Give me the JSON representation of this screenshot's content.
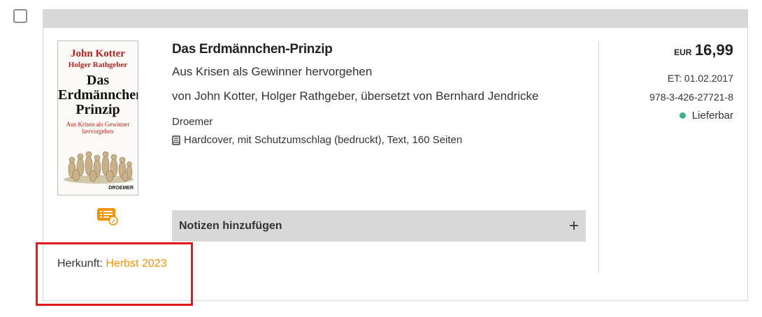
{
  "book": {
    "title": "Das Erdmännchen-Prinzip",
    "subtitle": "Aus Krisen als Gewinner hervorgehen",
    "authors": "von John Kotter, Holger Rathgeber, übersetzt von Bernhard Jendricke",
    "publisher": "Droemer",
    "format": "Hardcover, mit Schutzumschlag (bedruckt), Text, 160 Seiten",
    "cover": {
      "author": "John Kotter",
      "coauthor": "Holger Rathgeber",
      "title_line1": "Das",
      "title_line2": "Erdmännchen",
      "title_line3": "Prinzip",
      "subtitle_line1": "Aus Krisen als Gewinner",
      "subtitle_line2": "hervorgehen",
      "publisher": "DROEMER"
    }
  },
  "price": {
    "currency": "EUR",
    "value": "16,99"
  },
  "release_date": "ET: 01.02.2017",
  "isbn": "978-3-426-27721-8",
  "availability": {
    "label": "Lieferbar",
    "color": "#3dae8e"
  },
  "notes": {
    "label": "Notizen hinzufügen",
    "icon": "plus-icon"
  },
  "origin": {
    "label": "Herkunft:",
    "value": "Herbst 2023",
    "color": "#f39200"
  },
  "icons": {
    "notes_list": "notes-list-icon",
    "format": "book-icon"
  }
}
